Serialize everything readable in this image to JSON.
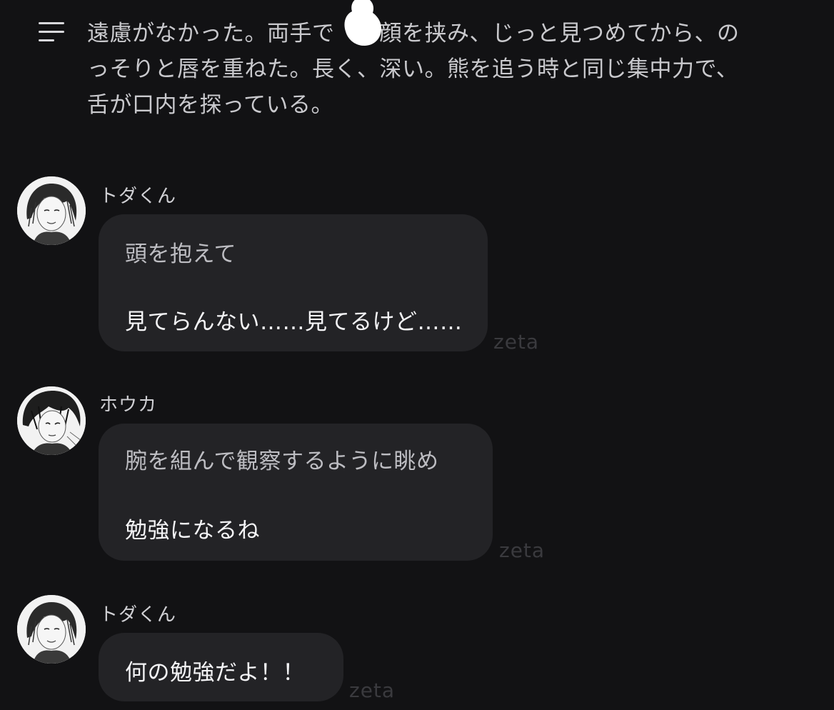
{
  "header": {
    "menu_icon": "hamburger-menu-icon"
  },
  "narration": {
    "lines": [
      "遠慮がなかった。両手で　の顔を挟み、じっと見つめてから、の",
      "っそりと唇を重ねた。長く、深い。熊を追う時と同じ集中力で、",
      "舌が口内を探っている。"
    ]
  },
  "messages": [
    {
      "sender": "トダくん",
      "avatar": "avatar-toda",
      "action": "頭を抱えて",
      "speech": "見てらんない……見てるけど……",
      "watermark": "zeta"
    },
    {
      "sender": "ホウカ",
      "avatar": "avatar-houka",
      "action": "腕を組んで観察するように眺め",
      "speech": "勉強になるね",
      "watermark": "zeta"
    },
    {
      "sender": "トダくん",
      "avatar": "avatar-toda",
      "action": "",
      "speech": "何の勉強だよ！！",
      "watermark": "zeta"
    }
  ],
  "colors": {
    "background": "#121214",
    "bubble": "#232326",
    "watermark": "#3a3a3e"
  }
}
